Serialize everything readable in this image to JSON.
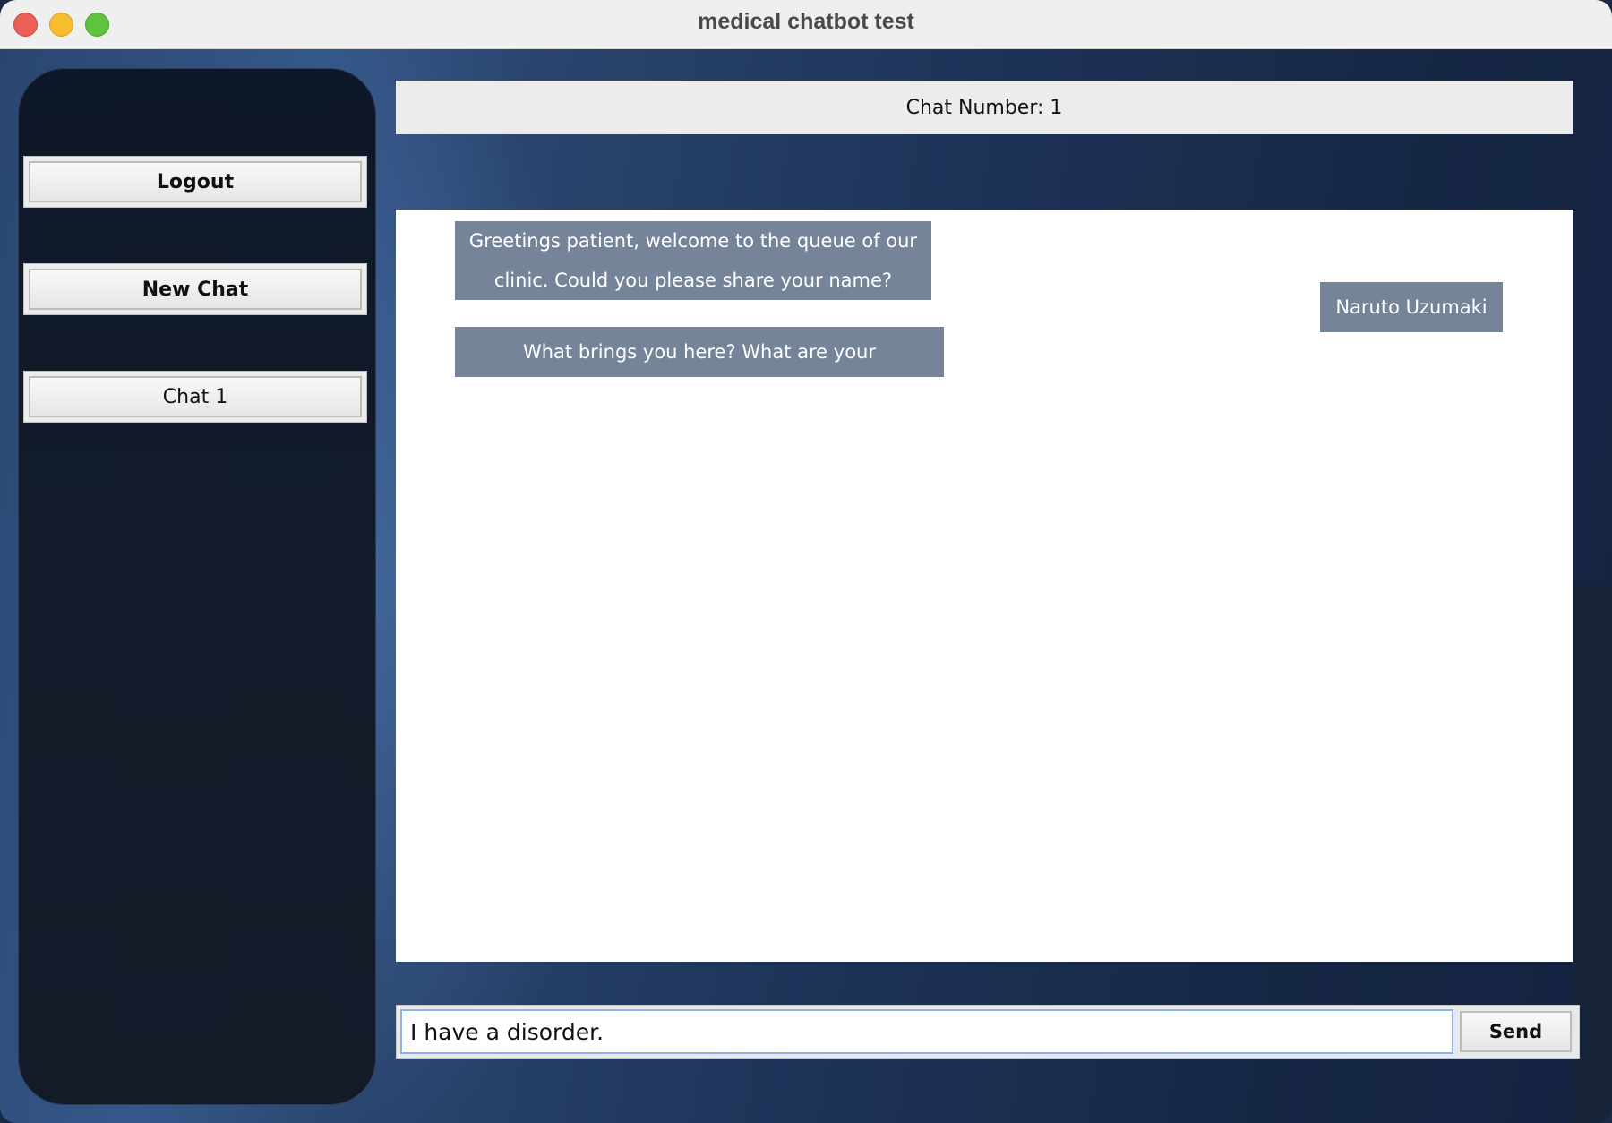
{
  "window": {
    "title": "medical chatbot test"
  },
  "sidebar": {
    "buttons": [
      {
        "label": "Logout"
      },
      {
        "label": "New Chat"
      },
      {
        "label": "Chat 1"
      }
    ]
  },
  "header": {
    "chat_number": "Chat Number: 1"
  },
  "messages": [
    {
      "sender": "bot",
      "text": "Greetings patient, welcome to the queue of our clinic. Could you please share your name?"
    },
    {
      "sender": "user",
      "text": "Naruto Uzumaki"
    },
    {
      "sender": "bot",
      "text": "What brings you here? What are your symptoms?"
    }
  ],
  "composer": {
    "value": "I have a disorder.",
    "send_label": "Send"
  },
  "colors": {
    "bubble": "#76849a",
    "header_bar": "#ececec",
    "background_blue": "#1d3358",
    "sidebar": "#131a28"
  }
}
